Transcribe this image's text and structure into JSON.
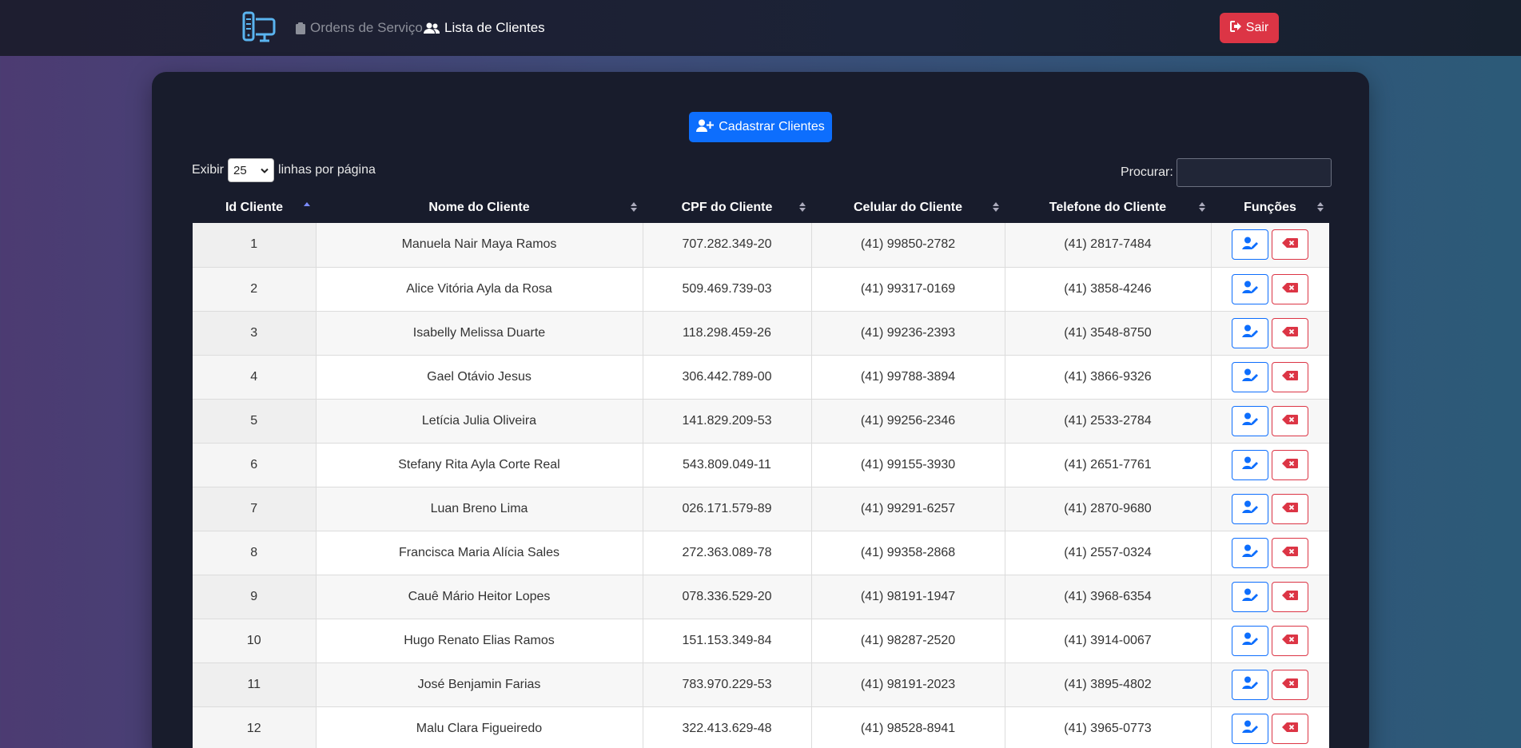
{
  "nav": {
    "links": [
      {
        "label": "Ordens de Serviço",
        "icon": "clipboard-icon",
        "active": false
      },
      {
        "label": "Lista de Clientes",
        "icon": "users-icon",
        "active": true
      }
    ],
    "logout_label": "Sair"
  },
  "add_button_label": "Cadastrar Clientes",
  "length_control": {
    "prefix": "Exibir",
    "value": "25",
    "suffix": "linhas por página"
  },
  "search": {
    "label": "Procurar:",
    "value": ""
  },
  "table": {
    "headers": [
      "Id Cliente",
      "Nome do Cliente",
      "CPF do Cliente",
      "Celular do Cliente",
      "Telefone do Cliente",
      "Funções"
    ],
    "rows": [
      [
        "1",
        "Manuela Nair Maya Ramos",
        "707.282.349-20",
        "(41) 99850-2782",
        "(41) 2817-7484"
      ],
      [
        "2",
        "Alice Vitória Ayla da Rosa",
        "509.469.739-03",
        "(41) 99317-0169",
        "(41) 3858-4246"
      ],
      [
        "3",
        "Isabelly Melissa Duarte",
        "118.298.459-26",
        "(41) 99236-2393",
        "(41) 3548-8750"
      ],
      [
        "4",
        "Gael Otávio Jesus",
        "306.442.789-00",
        "(41) 99788-3894",
        "(41) 3866-9326"
      ],
      [
        "5",
        "Letícia Julia Oliveira",
        "141.829.209-53",
        "(41) 99256-2346",
        "(41) 2533-2784"
      ],
      [
        "6",
        "Stefany Rita Ayla Corte Real",
        "543.809.049-11",
        "(41) 99155-3930",
        "(41) 2651-7761"
      ],
      [
        "7",
        "Luan Breno Lima",
        "026.171.579-89",
        "(41) 99291-6257",
        "(41) 2870-9680"
      ],
      [
        "8",
        "Francisca Maria Alícia Sales",
        "272.363.089-78",
        "(41) 99358-2868",
        "(41) 2557-0324"
      ],
      [
        "9",
        "Cauê Mário Heitor Lopes",
        "078.336.529-20",
        "(41) 98191-1947",
        "(41) 3968-6354"
      ],
      [
        "10",
        "Hugo Renato Elias Ramos",
        "151.153.349-84",
        "(41) 98287-2520",
        "(41) 3914-0067"
      ],
      [
        "11",
        "José Benjamin Farias",
        "783.970.229-53",
        "(41) 98191-2023",
        "(41) 3895-4802"
      ],
      [
        "12",
        "Malu Clara Figueiredo",
        "322.413.629-48",
        "(41) 98528-8941",
        "(41) 3965-0773"
      ]
    ]
  },
  "colors": {
    "primary": "#0d6efd",
    "danger": "#dc3545",
    "navbar": "#1b1f33",
    "card": "#181c2c"
  }
}
